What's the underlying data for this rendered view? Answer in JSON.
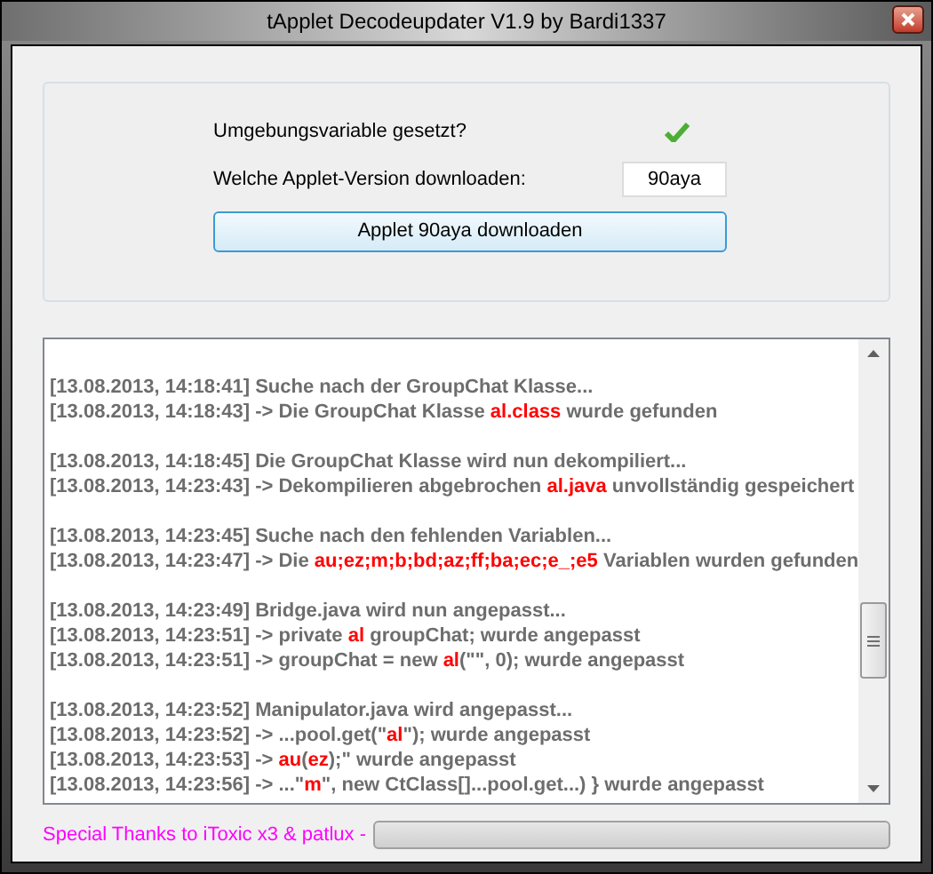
{
  "window": {
    "title": "tApplet Decodeupdater V1.9 by Bardi1337"
  },
  "settings": {
    "env_label": "Umgebungsvariable gesetzt?",
    "env_checked": true,
    "version_label": "Welche Applet-Version downloaden:",
    "version_value": "90aya",
    "download_button": "Applet 90aya downloaden"
  },
  "log": [
    [
      "[13.08.2013, 14:18:41] Suche nach der GroupChat Klasse...",
      "[13.08.2013, 14:18:43] -> Die GroupChat Klasse **al.class** wurde gefunden"
    ],
    [
      "[13.08.2013, 14:18:45] Die GroupChat Klasse wird nun dekompiliert...",
      "[13.08.2013, 14:23:43] -> Dekompilieren abgebrochen **al.java** unvollständig gespeichert"
    ],
    [
      "[13.08.2013, 14:23:45] Suche nach den fehlenden Variablen...",
      "[13.08.2013, 14:23:47] -> Die **au;ez;m;b;bd;az;ff;ba;ec;e_;e5** Variablen wurden gefunden"
    ],
    [
      "[13.08.2013, 14:23:49] Bridge.java wird nun angepasst...",
      "[13.08.2013, 14:23:51] -> private **al** groupChat; wurde angepasst",
      "[13.08.2013, 14:23:51] -> groupChat = new **al**(\"\", 0); wurde angepasst"
    ],
    [
      "[13.08.2013, 14:23:52] Manipulator.java wird angepasst...",
      "[13.08.2013, 14:23:52] -> ...pool.get(\"**al**\"); wurde angepasst",
      "[13.08.2013, 14:23:53] -> **au**(**ez**);\" wurde angepasst",
      "[13.08.2013, 14:23:56] -> ...\"**m**\", new CtClass[]...pool.get...) } wurde angepasst"
    ]
  ],
  "footer": {
    "thanks": "Special Thanks to iToxic x3 & patlux -",
    "progress": {
      "level": 0
    }
  }
}
